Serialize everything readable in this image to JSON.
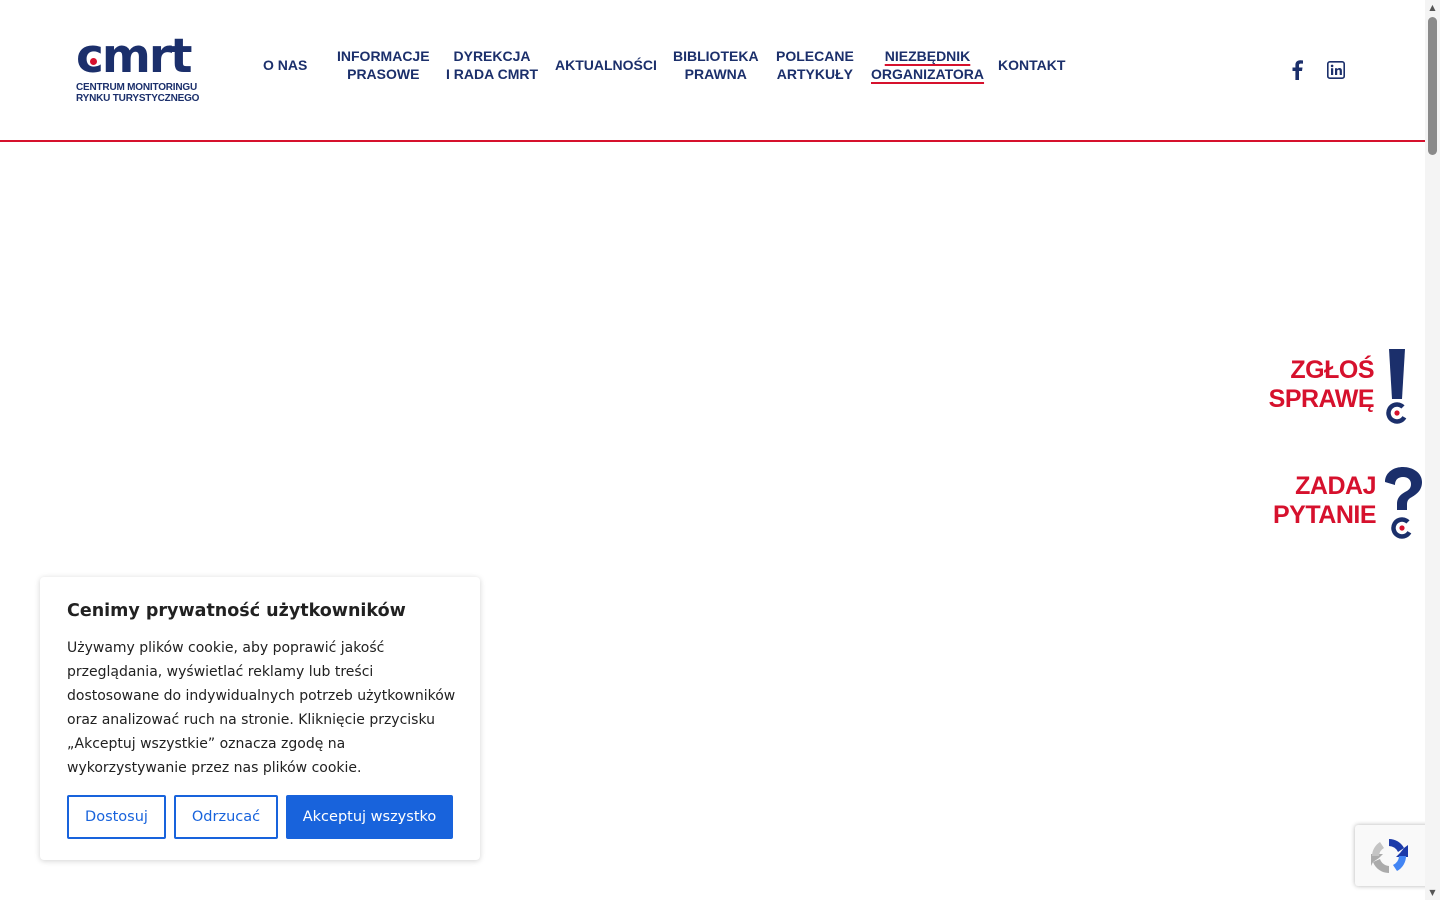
{
  "header": {
    "logo": {
      "mark": "cmrt",
      "subtitle_line1": "CENTRUM MONITORINGU",
      "subtitle_line2": "RYNKU TURYSTYCZNEGO"
    },
    "nav": [
      {
        "line1": "O NAS",
        "line2": ""
      },
      {
        "line1": "INFORMACJE",
        "line2": "PRASOWE"
      },
      {
        "line1": "DYREKCJA",
        "line2": "I RADA CMRT"
      },
      {
        "line1": "AKTUALNOŚCI",
        "line2": ""
      },
      {
        "line1": "BIBLIOTEKA",
        "line2": "PRAWNA"
      },
      {
        "line1": "POLECANE",
        "line2": "ARTYKUŁY"
      },
      {
        "line1": "NIEZBĘDNIK",
        "line2": "ORGANIZATORA"
      },
      {
        "line1": "KONTAKT",
        "line2": ""
      }
    ],
    "active_nav": "NIEZBĘDNIK ORGANIZATORA",
    "social": [
      "facebook-icon",
      "linkedin-icon"
    ]
  },
  "side_buttons": {
    "report": {
      "line1": "ZGŁOŚ",
      "line2": "SPRAWĘ",
      "icon": "exclamation-icon"
    },
    "ask": {
      "line1": "ZADAJ",
      "line2": "PYTANIE",
      "icon": "question-icon"
    }
  },
  "cookie_banner": {
    "title": "Cenimy prywatność użytkowników",
    "text": "Używamy plików cookie, aby poprawić jakość przeglądania, wyświetlać reklamy lub treści dostosowane do indywidualnych potrzeb użytkowników oraz analizować ruch na stronie. Kliknięcie przycisku „Akceptuj wszystkie” oznacza zgodę na wykorzystywanie przez nas plików cookie.",
    "buttons": {
      "customize": "Dostosuj",
      "reject": "Odrzucać",
      "accept": "Akceptuj wszystko"
    }
  },
  "colors": {
    "brand_navy": "#1b2f6b",
    "brand_red": "#d6112d",
    "cookie_blue": "#1863dc"
  }
}
